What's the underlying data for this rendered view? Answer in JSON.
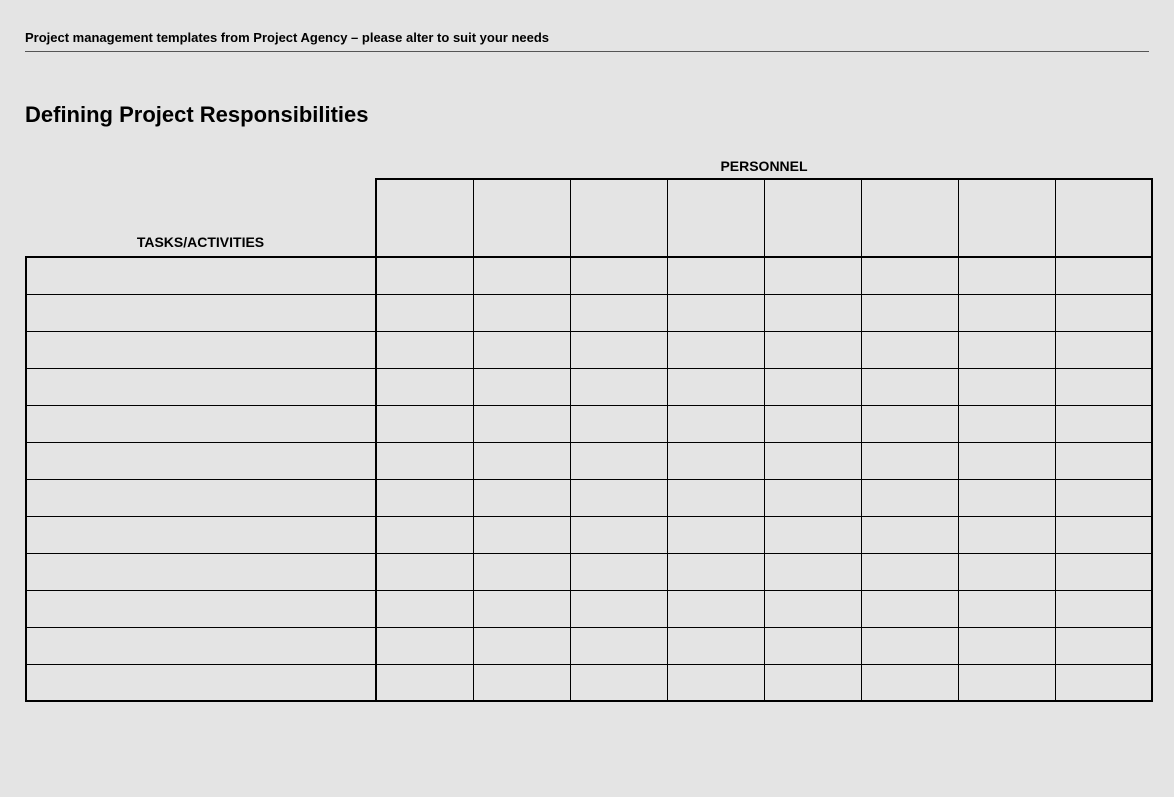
{
  "header": {
    "source_text": "Project management templates from Project Agency – please alter to suit your needs"
  },
  "title": "Defining Project Responsibilities",
  "table": {
    "personnel_label": "PERSONNEL",
    "tasks_label": "TASKS/ACTIVITIES",
    "personnel_columns": [
      "",
      "",
      "",
      "",
      "",
      "",
      "",
      ""
    ],
    "rows": [
      {
        "task": "",
        "cells": [
          "",
          "",
          "",
          "",
          "",
          "",
          "",
          ""
        ]
      },
      {
        "task": "",
        "cells": [
          "",
          "",
          "",
          "",
          "",
          "",
          "",
          ""
        ]
      },
      {
        "task": "",
        "cells": [
          "",
          "",
          "",
          "",
          "",
          "",
          "",
          ""
        ]
      },
      {
        "task": "",
        "cells": [
          "",
          "",
          "",
          "",
          "",
          "",
          "",
          ""
        ]
      },
      {
        "task": "",
        "cells": [
          "",
          "",
          "",
          "",
          "",
          "",
          "",
          ""
        ]
      },
      {
        "task": "",
        "cells": [
          "",
          "",
          "",
          "",
          "",
          "",
          "",
          ""
        ]
      },
      {
        "task": "",
        "cells": [
          "",
          "",
          "",
          "",
          "",
          "",
          "",
          ""
        ]
      },
      {
        "task": "",
        "cells": [
          "",
          "",
          "",
          "",
          "",
          "",
          "",
          ""
        ]
      },
      {
        "task": "",
        "cells": [
          "",
          "",
          "",
          "",
          "",
          "",
          "",
          ""
        ]
      },
      {
        "task": "",
        "cells": [
          "",
          "",
          "",
          "",
          "",
          "",
          "",
          ""
        ]
      },
      {
        "task": "",
        "cells": [
          "",
          "",
          "",
          "",
          "",
          "",
          "",
          ""
        ]
      },
      {
        "task": "",
        "cells": [
          "",
          "",
          "",
          "",
          "",
          "",
          "",
          ""
        ]
      }
    ]
  }
}
